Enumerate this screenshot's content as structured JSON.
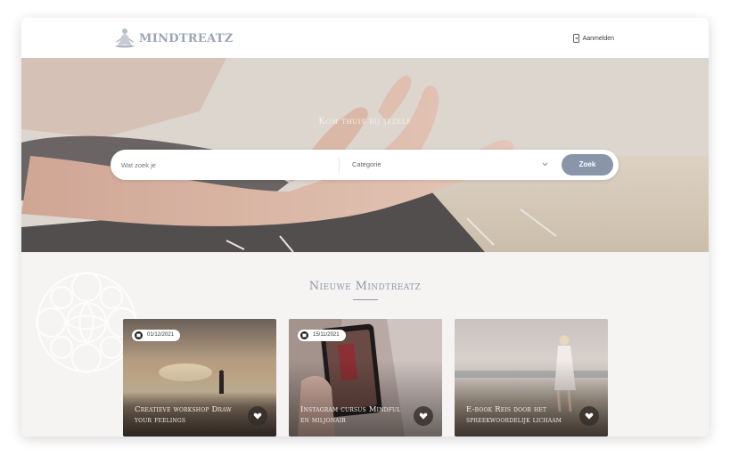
{
  "header": {
    "brand": "MINDTREATZ",
    "login_label": "Aanmelden"
  },
  "hero": {
    "tagline": "Kom thuis bij jezelf",
    "search": {
      "placeholder": "Wat zoek je",
      "category_label": "Categorie",
      "button_label": "Zoek"
    }
  },
  "section": {
    "title": "Nieuwe Mindtreatz"
  },
  "cards": [
    {
      "date": "01/12/2021",
      "title": "Creatieve workshop Draw your feelings",
      "icon": "heart-icon"
    },
    {
      "date": "15/11/2021",
      "title": "Instagram cursus Mindful en miljonair",
      "icon": "heart-icon"
    },
    {
      "date": "",
      "title": "E-book Reis door het spreekwoordelijk lichaam",
      "icon": "heart-icon"
    }
  ],
  "colors": {
    "accent": "#8996a9",
    "background": "#f5f4f2"
  }
}
